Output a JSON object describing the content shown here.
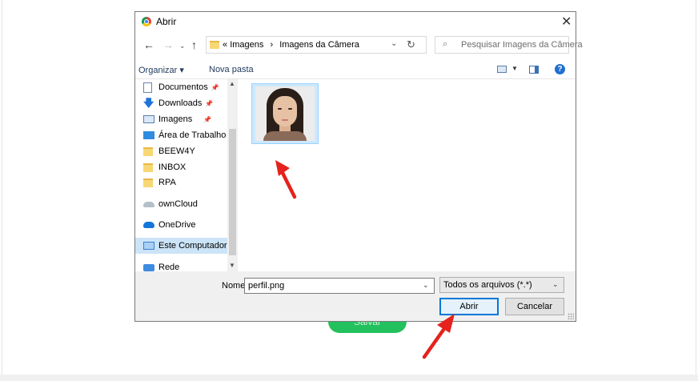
{
  "page": {
    "submit_button_label": "Salvar"
  },
  "dialog": {
    "title": "Abrir",
    "address": {
      "prefix": "«",
      "path": [
        "Imagens",
        "Imagens da Câmera"
      ],
      "separator": "›"
    },
    "search_placeholder": "Pesquisar Imagens da Câmera",
    "toolbar": {
      "organize": "Organizar ▾",
      "new_folder": "Nova pasta",
      "help": "?"
    },
    "nav_items": [
      {
        "label": "Documentos",
        "icon": "document-icon",
        "pinned": true
      },
      {
        "label": "Downloads",
        "icon": "download-icon",
        "pinned": true
      },
      {
        "label": "Imagens",
        "icon": "pictures-icon",
        "pinned": true
      },
      {
        "label": "Área de Trabalho",
        "icon": "desktop-icon",
        "pinned": false
      },
      {
        "label": "BEEW4Y",
        "icon": "folder-icon",
        "pinned": false
      },
      {
        "label": "INBOX",
        "icon": "folder-icon",
        "pinned": false
      },
      {
        "label": "RPA",
        "icon": "folder-icon",
        "pinned": false
      },
      {
        "label": "ownCloud",
        "icon": "owncloud-icon",
        "pinned": false
      },
      {
        "label": "OneDrive",
        "icon": "onedrive-icon",
        "pinned": false
      },
      {
        "label": "Este Computador",
        "icon": "computer-icon",
        "pinned": false,
        "selected": true
      },
      {
        "label": "Rede",
        "icon": "network-icon",
        "pinned": false
      }
    ],
    "file": {
      "name": "perfil.png",
      "selected": true
    },
    "filename_label": "Nome:",
    "filename_value": "perfil.png",
    "filetype_value": "Todos os arquivos (*.*)",
    "open_button": "Abrir",
    "cancel_button": "Cancelar"
  },
  "colors": {
    "accent": "#0078d7",
    "selection": "#cce8ff",
    "annotation_arrow": "#e5221d",
    "submit_green": "#22c15e"
  }
}
